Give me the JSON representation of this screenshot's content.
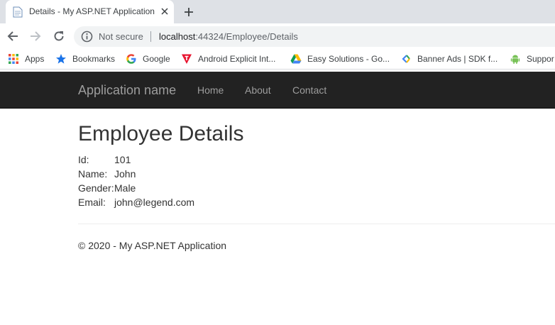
{
  "browser": {
    "tab": {
      "title": "Details - My ASP.NET Application",
      "favicon": "document-icon"
    },
    "address_bar": {
      "security_label": "Not secure",
      "url_host": "localhost",
      "url_rest": ":44324/Employee/Details"
    },
    "bookmarks": [
      {
        "label": "Apps",
        "icon": "apps-grid-icon"
      },
      {
        "label": "Bookmarks",
        "icon": "star-icon"
      },
      {
        "label": "Google",
        "icon": "google-icon"
      },
      {
        "label": "Android Explicit Int...",
        "icon": "red-triangle-icon"
      },
      {
        "label": "Easy Solutions - Go...",
        "icon": "drive-icon"
      },
      {
        "label": "Banner Ads  |  SDK f...",
        "icon": "ads-icon"
      },
      {
        "label": "Suppor",
        "icon": "android-icon"
      }
    ]
  },
  "site": {
    "brand": "Application name",
    "nav": [
      "Home",
      "About",
      "Contact"
    ]
  },
  "page": {
    "heading": "Employee Details",
    "details": [
      {
        "label": "Id:",
        "value": "101"
      },
      {
        "label": "Name:",
        "value": "John"
      },
      {
        "label": "Gender:",
        "value": "Male"
      },
      {
        "label": "Email:",
        "value": "john@legend.com"
      }
    ],
    "footer": "© 2020 - My ASP.NET Application"
  },
  "colors": {
    "navbar_bg": "#222222",
    "nav_text": "#9d9d9d",
    "body_text": "#333333",
    "tabstrip_bg": "#dee1e6"
  }
}
